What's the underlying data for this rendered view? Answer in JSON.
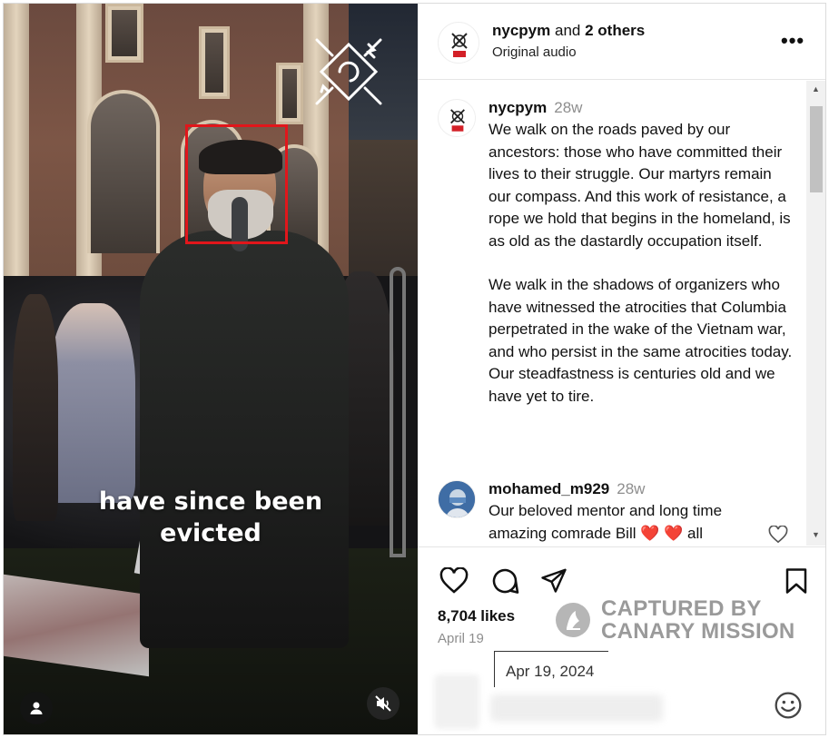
{
  "post": {
    "header": {
      "username": "nycpym",
      "connector": "and",
      "others": "2 others",
      "audio": "Original audio",
      "more_label": "•••"
    },
    "video_caption": {
      "line1": "have since been",
      "line2": "evicted"
    },
    "comments": [
      {
        "username": "nycpym",
        "age": "28w",
        "text": "We walk on the roads paved by our ancestors: those who have committed their lives to their struggle. Our martyrs remain our compass. And this work of resistance, a rope we hold that begins in the homeland, is as old as the dastardly occupation itself.",
        "text2": "We walk in the shadows of organizers who have witnessed the atrocities that Columbia perpetrated in the wake of the Vietnam war, and who persist in the same atrocities today. Our steadfastness is centuries old and we have yet to tire."
      },
      {
        "username": "mohamed_m929",
        "age": "28w",
        "text_line1": "Our beloved mentor and long time",
        "text_line2": "amazing comrade Bill",
        "text_line2_hearts": "❤️ ❤️",
        "text_line2_tail": "all"
      }
    ],
    "likes": "8,704 likes",
    "date": "April 19",
    "date_tooltip": "Apr 19, 2024",
    "watermark": {
      "line1": "CAPTURED BY",
      "line2": "CANARY MISSION"
    },
    "colors": {
      "highlight_box": "#e1161b",
      "muted_text": "#8e8e8e",
      "heart_red": "#e0245e"
    },
    "icons": [
      "heart-icon",
      "comment-icon",
      "share-icon",
      "bookmark-icon",
      "emoji-icon",
      "user-icon",
      "mute-icon",
      "more-icon"
    ]
  }
}
